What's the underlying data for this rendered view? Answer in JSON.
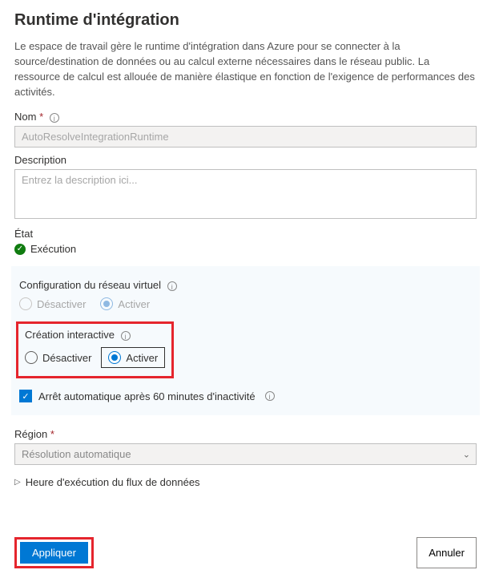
{
  "header": {
    "title": "Runtime d'intégration",
    "intro": "Le espace de travail gère le runtime d'intégration dans Azure pour se connecter à la source/destination de données ou au calcul externe nécessaires dans le réseau public. La ressource de calcul est allouée de manière élastique en fonction de l'exigence de performances des activités."
  },
  "fields": {
    "name_label": "Nom",
    "name_placeholder": "AutoResolveIntegrationRuntime",
    "name_value": "",
    "description_label": "Description",
    "description_placeholder": "Entrez la description ici...",
    "description_value": "",
    "etat_label": "État",
    "etat_value": "Exécution",
    "region_label": "Région",
    "region_value": "Résolution automatique"
  },
  "vnet": {
    "heading": "Configuration du réseau virtuel",
    "disable": "Désactiver",
    "enable": "Activer",
    "selected": "enable",
    "disabled": true
  },
  "interactive": {
    "heading": "Création interactive",
    "disable": "Désactiver",
    "enable": "Activer",
    "selected": "enable"
  },
  "autostop": {
    "label": "Arrêt automatique après 60 minutes d'inactivité",
    "checked": true
  },
  "expander": {
    "label": "Heure d'exécution du flux de données"
  },
  "buttons": {
    "apply": "Appliquer",
    "cancel": "Annuler"
  },
  "required_marker": "*"
}
